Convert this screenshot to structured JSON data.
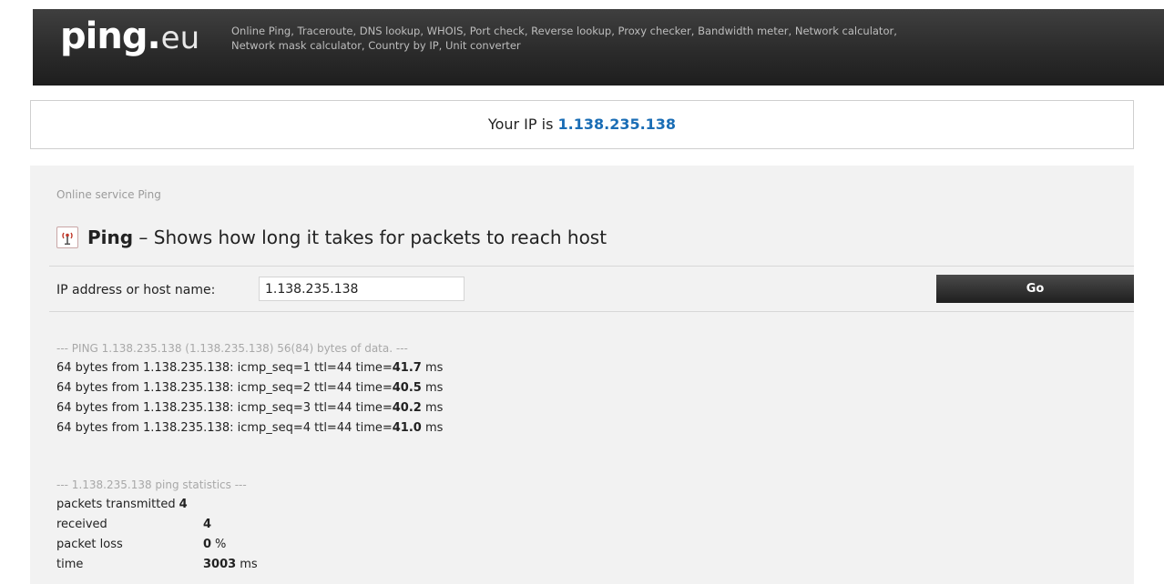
{
  "header": {
    "logo_main": "ping",
    "logo_dot": ".",
    "logo_tld": "eu",
    "links": [
      "Online Ping",
      "Traceroute",
      "DNS lookup",
      "WHOIS",
      "Port check",
      "Reverse lookup",
      "Proxy checker",
      "Bandwidth meter",
      "Network calculator",
      "Network mask calculator",
      "Country by IP",
      "Unit converter"
    ]
  },
  "ip_banner": {
    "prefix": "Your IP is",
    "ip": "1.138.235.138"
  },
  "breadcrumb": "Online service Ping",
  "title": {
    "strong": "Ping",
    "rest": " – Shows how long it takes for packets to reach host"
  },
  "form": {
    "label": "IP address or host name:",
    "value": "1.138.235.138",
    "go_label": "Go"
  },
  "results": {
    "header": "--- PING 1.138.235.138 (1.138.235.138) 56(84) bytes of data. ---",
    "lines": [
      {
        "text": "64 bytes from 1.138.235.138: icmp_seq=1 ttl=44 time=",
        "time": "41.7",
        "unit": "ms"
      },
      {
        "text": "64 bytes from 1.138.235.138: icmp_seq=2 ttl=44 time=",
        "time": "40.5",
        "unit": "ms"
      },
      {
        "text": "64 bytes from 1.138.235.138: icmp_seq=3 ttl=44 time=",
        "time": "40.2",
        "unit": "ms"
      },
      {
        "text": "64 bytes from 1.138.235.138: icmp_seq=4 ttl=44 time=",
        "time": "41.0",
        "unit": "ms"
      }
    ]
  },
  "statistics": {
    "header": "--- 1.138.235.138 ping statistics ---",
    "rows": [
      {
        "label": "packets transmitted",
        "value": "4",
        "unit": ""
      },
      {
        "label": "received",
        "value": "4",
        "unit": ""
      },
      {
        "label": "packet loss",
        "value": "0",
        "unit": "%"
      },
      {
        "label": "time",
        "value": "3003",
        "unit": "ms"
      }
    ]
  },
  "colors": {
    "header_bg": "#2b2b2b",
    "ip_link": "#1a6db5",
    "panel_bg": "#f2f2f2",
    "button_bg": "#2a2a2a"
  },
  "icons": {
    "ping": "antenna-icon"
  }
}
